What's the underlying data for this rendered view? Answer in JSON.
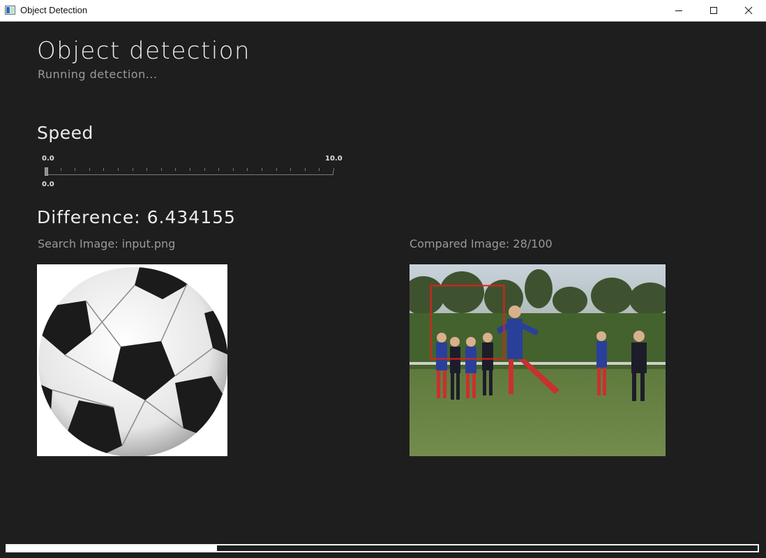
{
  "window": {
    "title": "Object Detection",
    "controls": [
      "minimize-icon",
      "maximize-icon",
      "close-icon"
    ]
  },
  "header": {
    "title": "Object detection",
    "status": "Running detection..."
  },
  "speed": {
    "label": "Speed",
    "min_label": "0.0",
    "max_label": "10.0",
    "value_label": "0.0",
    "value": 0.0,
    "min": 0.0,
    "max": 10.0
  },
  "result": {
    "difference": "Difference: 6.434155",
    "search_caption": "Search Image: input.png",
    "compared_caption": "Compared Image: 28/100"
  },
  "progress": {
    "fraction": 0.28
  },
  "colors": {
    "background": "#1e1e1f",
    "detection_box": "#e0201a",
    "progress_fill": "#ffffff"
  }
}
